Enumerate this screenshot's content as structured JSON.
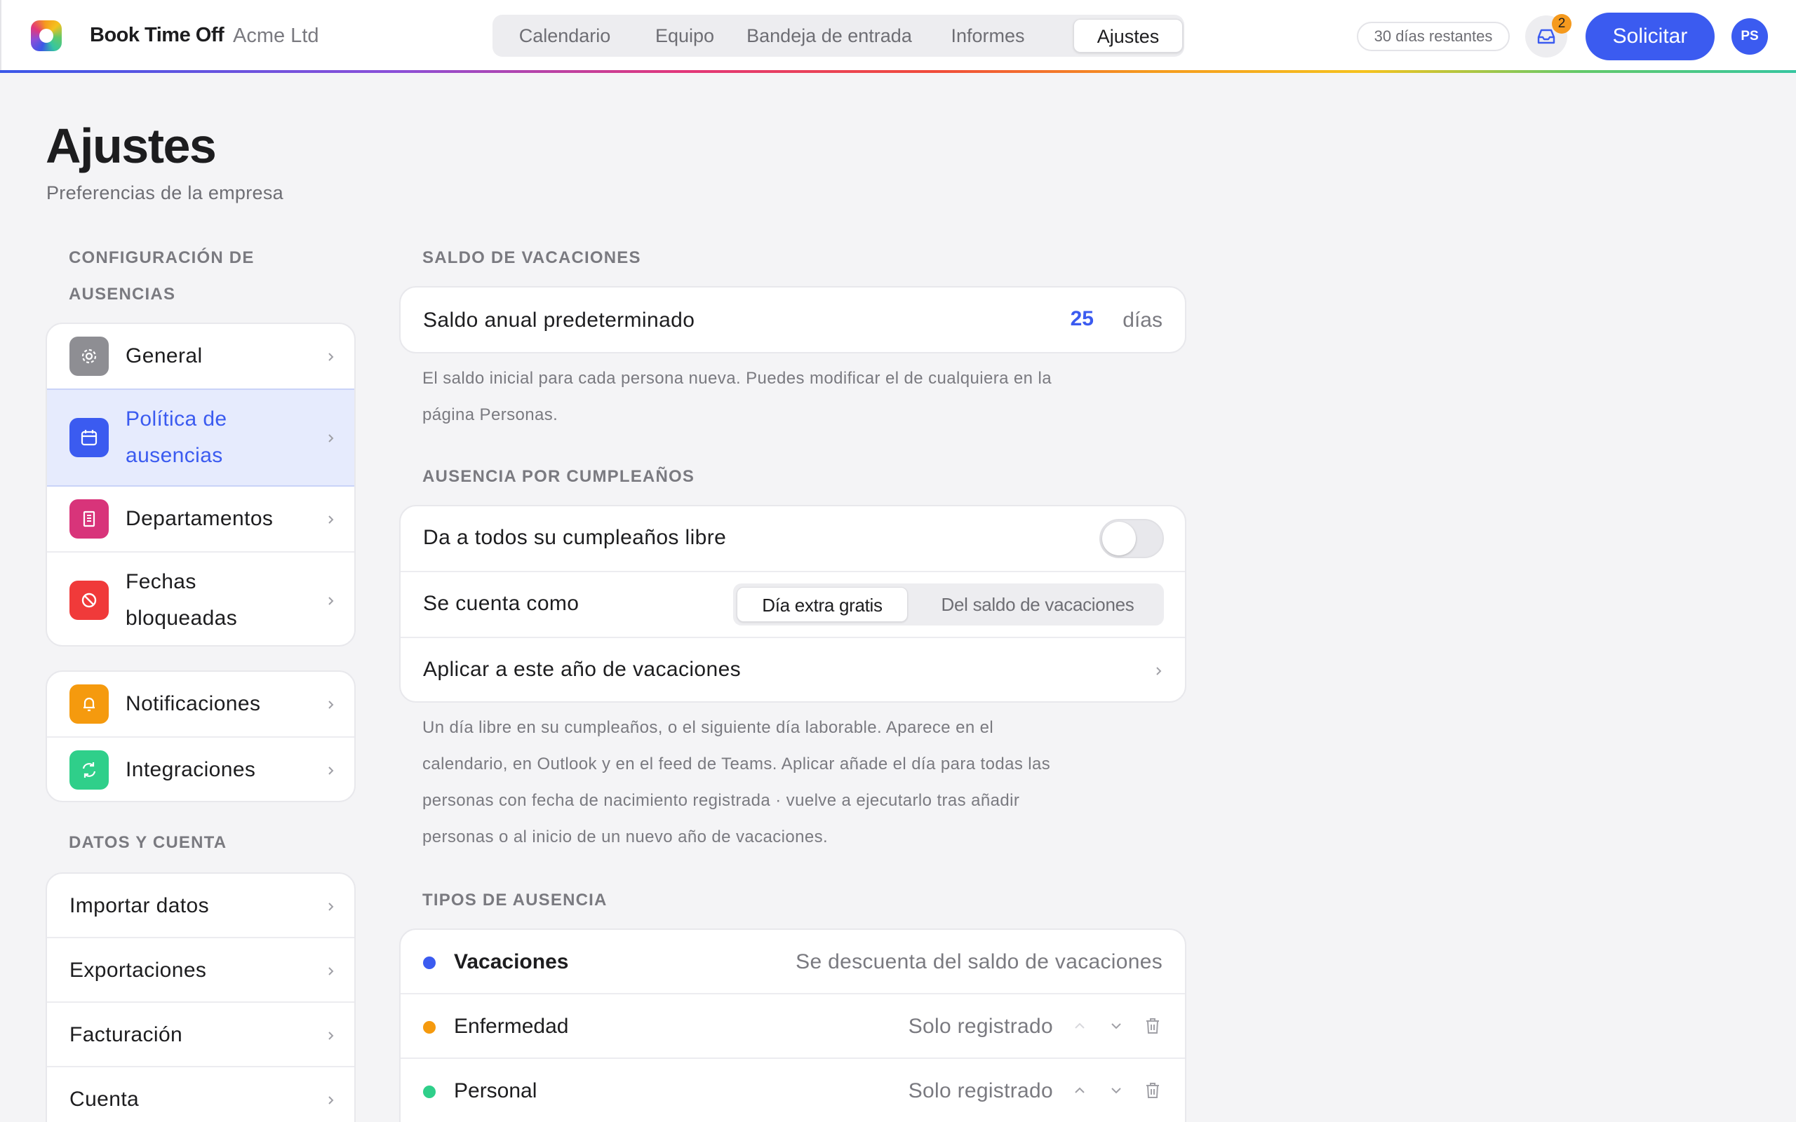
{
  "app": {
    "brand": "Book Time Off",
    "org": "Acme Ltd",
    "nav": [
      "Calendario",
      "Equipo",
      "Bandeja de entrada",
      "Informes",
      "Ajustes"
    ],
    "active_nav": "Ajustes",
    "days_remaining": "30 días restantes",
    "inbox_badge": "2",
    "request_label": "Solicitar",
    "avatar_initials": "PS",
    "accent_color": "#3b5bf0"
  },
  "page": {
    "title": "Ajustes",
    "subtitle": "Preferencias de la empresa"
  },
  "sidebar": {
    "section1_line1": "CONFIGURACIÓN DE",
    "section1_line2": "AUSENCIAS",
    "group1": [
      {
        "label": "General",
        "icon": "gear-icon",
        "color": "#8e8e93"
      },
      {
        "label_line1": "Política de",
        "label_line2": "ausencias",
        "icon": "calendar-icon",
        "color": "#3b5bf0",
        "active": true
      },
      {
        "label": "Departamentos",
        "icon": "building-icon",
        "color": "#d8347a"
      },
      {
        "label_line1": "Fechas",
        "label_line2": "bloqueadas",
        "icon": "block-icon",
        "color": "#f03a3a"
      }
    ],
    "group2": [
      {
        "label": "Notificaciones",
        "icon": "bell-icon",
        "color": "#f59a0e"
      },
      {
        "label": "Integraciones",
        "icon": "sync-icon",
        "color": "#2fcf8a"
      }
    ],
    "section2": "DATOS Y CUENTA",
    "group3": [
      {
        "label": "Importar datos"
      },
      {
        "label": "Exportaciones"
      },
      {
        "label": "Facturación"
      },
      {
        "label": "Cuenta"
      }
    ]
  },
  "allowance": {
    "section": "SALDO DE VACACIONES",
    "label": "Saldo anual predeterminado",
    "value": "25",
    "unit": "días",
    "help_line1": "El saldo inicial para cada persona nueva. Puedes modificar el de cualquiera en la",
    "help_line2": "página Personas."
  },
  "birthday": {
    "section": "AUSENCIA POR CUMPLEAÑOS",
    "toggle_label": "Da a todos su cumpleaños libre",
    "toggle_on": false,
    "counts_as_label": "Se cuenta como",
    "options": [
      "Día extra gratis",
      "Del saldo de vacaciones"
    ],
    "selected_option": "Día extra gratis",
    "apply_label": "Aplicar a este año de vacaciones",
    "help_line1": "Un día libre en su cumpleaños, o el siguiente día laborable. Aparece en el",
    "help_line2": "calendario, en Outlook y en el feed de Teams. Aplicar añade el día para todas las",
    "help_line3": "personas con fecha de nacimiento registrada · vuelve a ejecutarlo tras añadir",
    "help_line4": "personas o al inicio de un nuevo año de vacaciones."
  },
  "leave_types": {
    "section": "TIPOS DE AUSENCIA",
    "items": [
      {
        "name": "Vacaciones",
        "rule": "Se descuenta del saldo de vacaciones",
        "color": "#3b5bf0"
      },
      {
        "name": "Enfermedad",
        "rule": "Solo registrado",
        "color": "#f59a0e"
      },
      {
        "name": "Personal",
        "rule": "Solo registrado",
        "color": "#2fcf8a"
      }
    ]
  }
}
